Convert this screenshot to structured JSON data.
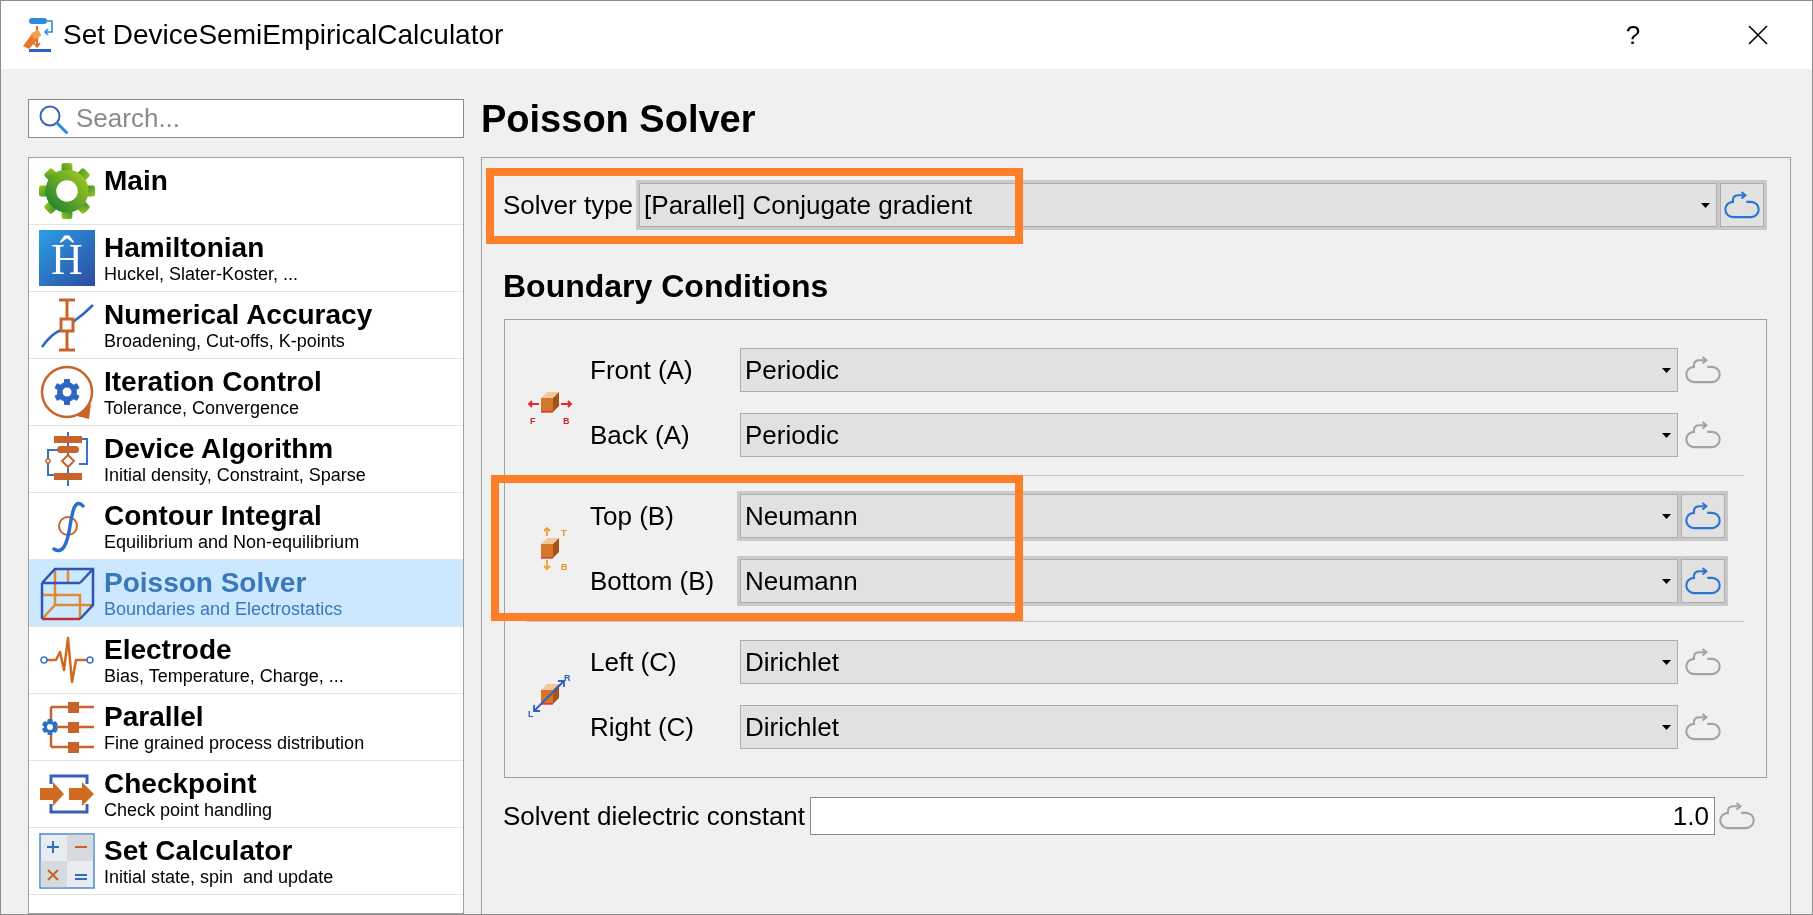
{
  "window": {
    "title": "Set DeviceSemiEmpiricalCalculator",
    "help": "?"
  },
  "search": {
    "placeholder": "Search..."
  },
  "sidebar": {
    "items": [
      {
        "kind": "main",
        "title": "Main",
        "selected": false
      },
      {
        "kind": "hamiltonian",
        "title": "Hamiltonian",
        "subtitle": "Huckel, Slater-Koster, ...",
        "icon_text": "Ĥ",
        "selected": false
      },
      {
        "kind": "accuracy",
        "title": "Numerical Accuracy",
        "subtitle": "Broadening, Cut-offs, K-points",
        "selected": false
      },
      {
        "kind": "iteration",
        "title": "Iteration Control",
        "subtitle": "Tolerance, Convergence",
        "selected": false
      },
      {
        "kind": "algorithm",
        "title": "Device Algorithm",
        "subtitle": "Initial density, Constraint, Sparse",
        "selected": false
      },
      {
        "kind": "contour",
        "title": "Contour Integral",
        "subtitle": "Equilibrium and Non-equilibrium",
        "selected": false
      },
      {
        "kind": "poisson",
        "title": "Poisson Solver",
        "subtitle": "Boundaries and Electrostatics",
        "selected": true
      },
      {
        "kind": "electrode",
        "title": "Electrode",
        "subtitle": "Bias, Temperature, Charge, ...",
        "selected": false
      },
      {
        "kind": "parallel",
        "title": "Parallel",
        "subtitle": "Fine grained process distribution",
        "selected": false
      },
      {
        "kind": "checkpoint",
        "title": "Checkpoint",
        "subtitle": "Check point handling",
        "selected": false
      },
      {
        "kind": "calculator",
        "title": "Set Calculator",
        "subtitle": "Initial state, spin  and update",
        "selected": false
      }
    ]
  },
  "panel": {
    "title": "Poisson Solver",
    "solver_type": {
      "label": "Solver type",
      "value": "[Parallel] Conjugate gradient",
      "modified": true,
      "highlighted": true
    },
    "boundary_conditions": {
      "title": "Boundary Conditions",
      "groups": [
        {
          "kind": "frontback",
          "icon_labels": [
            "F",
            "B"
          ],
          "highlighted": false,
          "rows": [
            {
              "label": "Front (A)",
              "value": "Periodic",
              "modified": false
            },
            {
              "label": "Back (A)",
              "value": "Periodic",
              "modified": false
            }
          ]
        },
        {
          "kind": "topbottom",
          "icon_labels": [
            "T",
            "B"
          ],
          "highlighted": true,
          "rows": [
            {
              "label": "Top (B)",
              "value": "Neumann",
              "modified": true
            },
            {
              "label": "Bottom (B)",
              "value": "Neumann",
              "modified": true
            }
          ]
        },
        {
          "kind": "leftright",
          "icon_labels": [
            "R",
            "L"
          ],
          "highlighted": false,
          "rows": [
            {
              "label": "Left (C)",
              "value": "Dirichlet",
              "modified": false
            },
            {
              "label": "Right (C)",
              "value": "Dirichlet",
              "modified": false
            }
          ]
        }
      ]
    },
    "solvent_dielectric": {
      "label": "Solvent dielectric constant",
      "value": "1.0",
      "modified": false
    }
  }
}
